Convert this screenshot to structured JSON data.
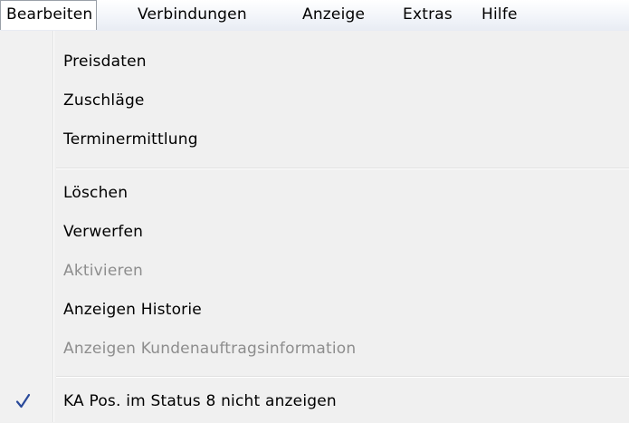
{
  "menubar": {
    "items": [
      {
        "label": "Bearbeiten"
      },
      {
        "label": "Verbindungen"
      },
      {
        "label": "Anzeige"
      },
      {
        "label": "Extras"
      },
      {
        "label": "Hilfe"
      }
    ]
  },
  "menu": {
    "items": [
      {
        "label": "Preisdaten",
        "enabled": true
      },
      {
        "label": "Zuschläge",
        "enabled": true
      },
      {
        "label": "Terminermittlung",
        "enabled": true
      },
      {
        "label": "Löschen",
        "enabled": true
      },
      {
        "label": "Verwerfen",
        "enabled": true
      },
      {
        "label": "Aktivieren",
        "enabled": false
      },
      {
        "label": "Anzeigen Historie",
        "enabled": true
      },
      {
        "label": "Anzeigen Kundenauftragsinformation",
        "enabled": false
      },
      {
        "label": "KA Pos. im Status 8 nicht anzeigen",
        "enabled": true,
        "checked": true,
        "icon": "check-icon"
      }
    ]
  },
  "colors": {
    "disabled_text": "#8d8d8d",
    "check_mark": "#2a4a9a"
  }
}
